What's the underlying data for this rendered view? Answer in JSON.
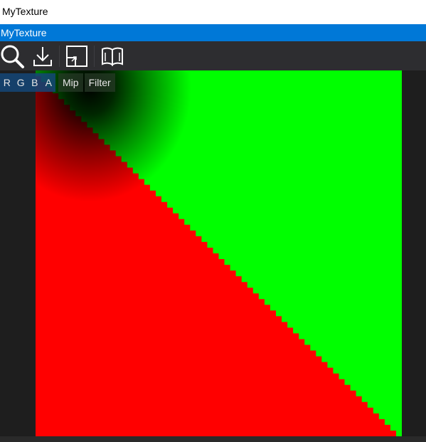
{
  "window": {
    "title": "MyTexture"
  },
  "panel": {
    "header": "MyTexture"
  },
  "toolbar": {
    "tools": [
      {
        "name": "zoom-icon"
      },
      {
        "name": "download-icon"
      },
      {
        "name": "fit-to-window-icon"
      },
      {
        "name": "book-icon"
      }
    ]
  },
  "overlay": {
    "channels": [
      "R",
      "G",
      "B",
      "A"
    ],
    "mip_label": "Mip",
    "filter_label": "Filter"
  },
  "colors": {
    "accent": "#0078d7",
    "toolbar_bg": "#2d2d30",
    "viewer_bg": "#1e1e1e",
    "texture_green": "#00ff00",
    "texture_red": "#ff0000"
  }
}
